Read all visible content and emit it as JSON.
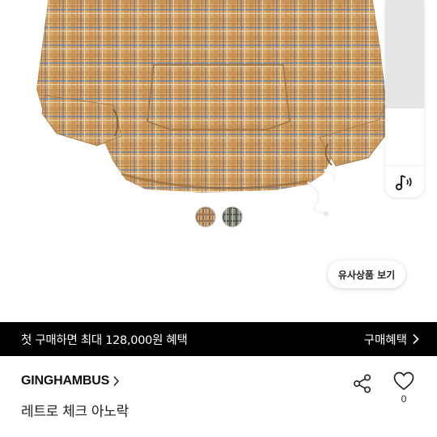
{
  "product_image": {
    "alt": "plaid anorak",
    "swatch_count": 2
  },
  "side_panel": {
    "icon": "music-note-sound-icon"
  },
  "similar_button": {
    "label": "유사상품 보기"
  },
  "promo_banner": {
    "text": "첫 구매하면 최대 128,000원 혜택",
    "link_label": "구매혜택",
    "background": "#000000"
  },
  "product": {
    "brand": "GINGHAMBUS",
    "title": "레트로 체크 아노락",
    "like_count": "0"
  },
  "icons": {
    "brand_chevron": "chevron-right-icon",
    "promo_chevron": "chevron-right-icon",
    "share": "share-icon",
    "like": "heart-outline-icon"
  }
}
